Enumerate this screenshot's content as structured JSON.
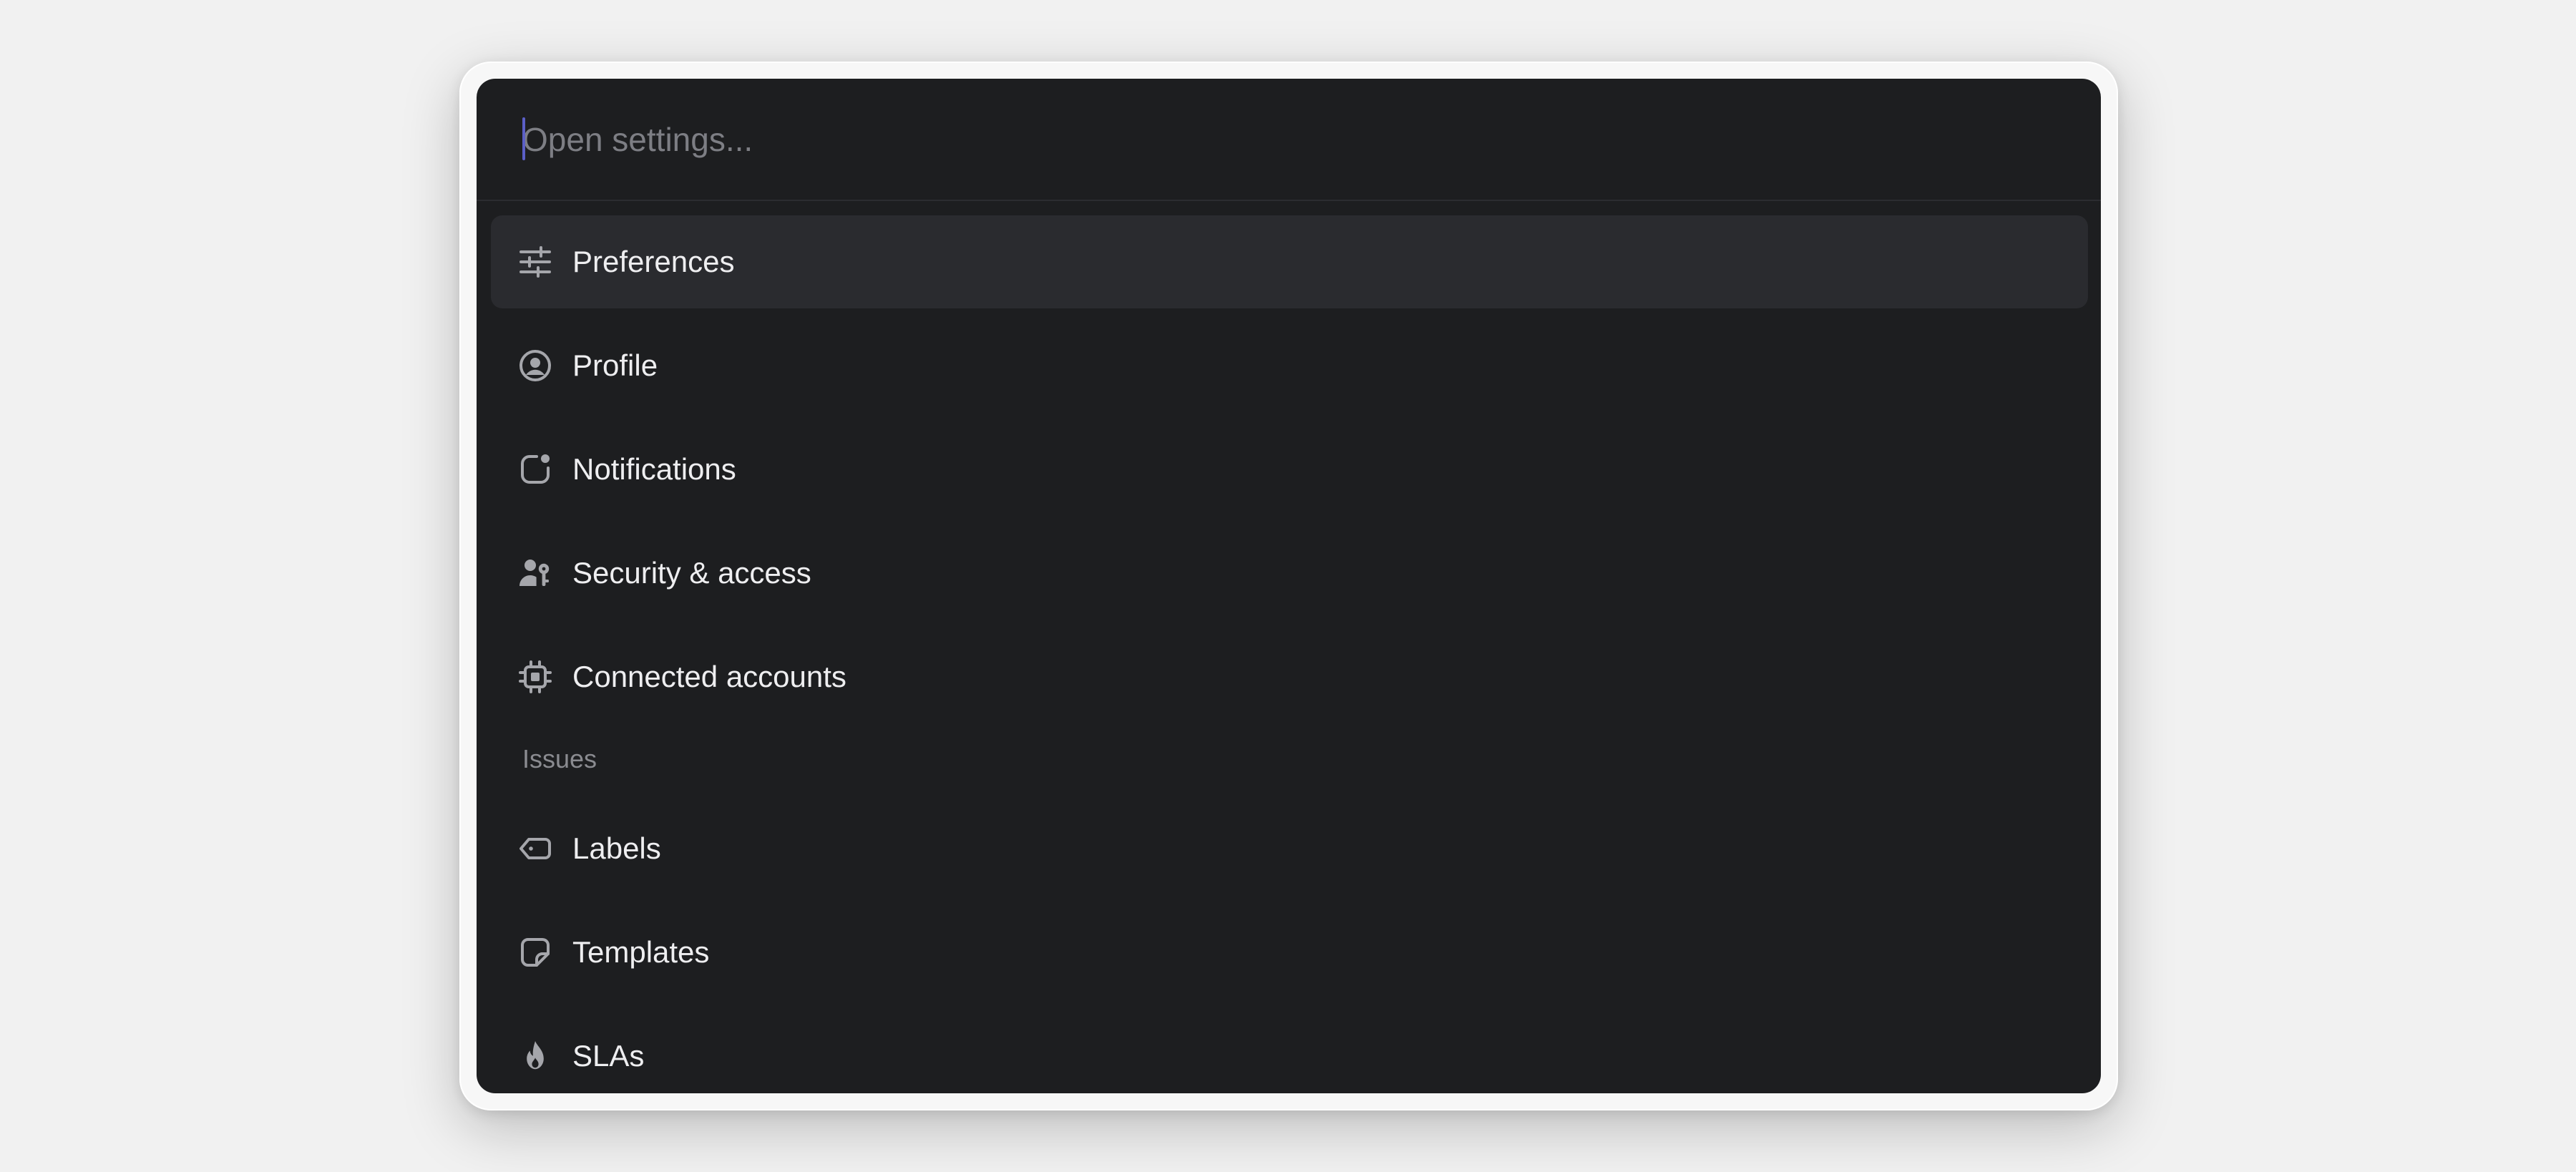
{
  "search": {
    "placeholder": "Open settings...",
    "value": ""
  },
  "items": [
    {
      "label": "Preferences",
      "icon": "sliders-icon",
      "selected": true
    },
    {
      "label": "Profile",
      "icon": "user-circle-icon"
    },
    {
      "label": "Notifications",
      "icon": "notification-badge-icon"
    },
    {
      "label": "Security & access",
      "icon": "user-key-icon"
    },
    {
      "label": "Connected accounts",
      "icon": "chip-icon"
    }
  ],
  "sections": [
    {
      "header": "Issues",
      "items": [
        {
          "label": "Labels",
          "icon": "tag-icon"
        },
        {
          "label": "Templates",
          "icon": "sticky-note-icon"
        },
        {
          "label": "SLAs",
          "icon": "flame-icon"
        }
      ]
    }
  ],
  "colors": {
    "page_background": "#f1f1f1",
    "palette_background": "#1d1e20",
    "selected_row": "#2a2b2f",
    "caret_accent": "#5b5fc7",
    "text_primary": "#eeeef0",
    "text_muted": "#8a8b90",
    "icon": "#a5a6ab"
  }
}
